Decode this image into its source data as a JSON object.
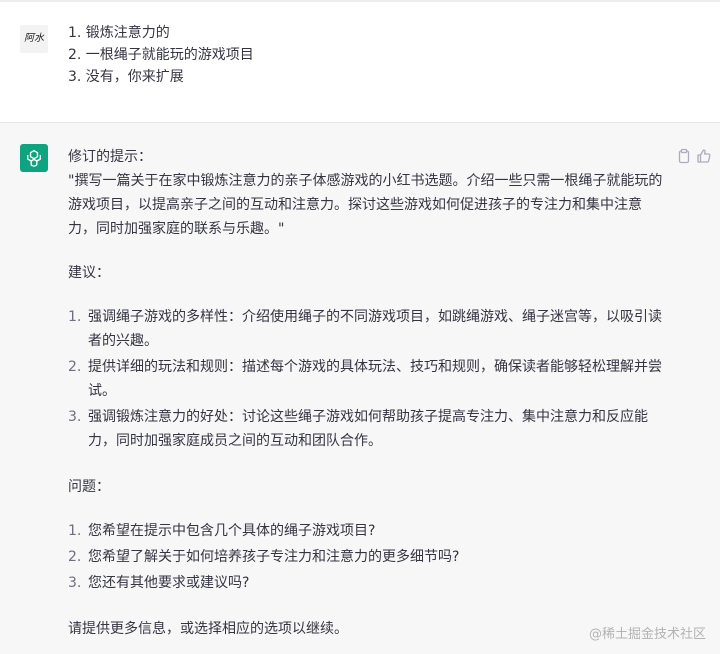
{
  "user": {
    "avatar_text": "阿水",
    "lines": [
      "1. 锻炼注意力的",
      "2. 一根绳子就能玩的游戏项目",
      "3. 没有，你来扩展"
    ]
  },
  "assistant": {
    "avatar_icon": "openai-logo-icon",
    "actions": [
      "copy-icon",
      "thumbs-up-icon"
    ],
    "revised_label": "修订的提示：",
    "prompt_text": "\"撰写一篇关于在家中锻炼注意力的亲子体感游戏的小红书选题。介绍一些只需一根绳子就能玩的游戏项目，以提高亲子之间的互动和注意力。探讨这些游戏如何促进孩子的专注力和集中注意力，同时加强家庭的联系与乐趣。\"",
    "suggestions_label": "建议：",
    "suggestions": [
      {
        "num": "1.",
        "text": "强调绳子游戏的多样性：介绍使用绳子的不同游戏项目，如跳绳游戏、绳子迷宫等，以吸引读者的兴趣。"
      },
      {
        "num": "2.",
        "text": "提供详细的玩法和规则：描述每个游戏的具体玩法、技巧和规则，确保读者能够轻松理解并尝试。"
      },
      {
        "num": "3.",
        "text": "强调锻炼注意力的好处：讨论这些绳子游戏如何帮助孩子提高专注力、集中注意力和反应能力，同时加强家庭成员之间的互动和团队合作。"
      }
    ],
    "questions_label": "问题：",
    "questions": [
      {
        "num": "1.",
        "text": "您希望在提示中包含几个具体的绳子游戏项目?"
      },
      {
        "num": "2.",
        "text": "您希望了解关于如何培养孩子专注力和注意力的更多细节吗?"
      },
      {
        "num": "3.",
        "text": "您还有其他要求或建议吗?"
      }
    ],
    "closing": "请提供更多信息，或选择相应的选项以继续。"
  },
  "watermark": "@稀土掘金技术社区",
  "colors": {
    "accent": "#10a37f",
    "text": "#343541",
    "assistant_bg": "#f7f7f8"
  }
}
